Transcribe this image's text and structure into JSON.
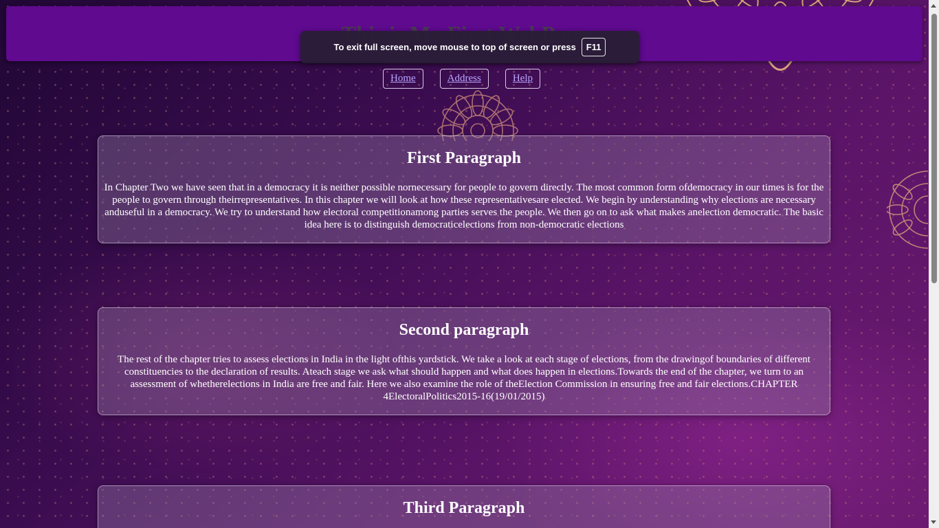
{
  "header": {
    "title": "This is My First WebPage"
  },
  "fullscreen_notice": {
    "message": "To exit full screen, move mouse to top of screen or press",
    "key": "F11"
  },
  "nav": {
    "items": [
      {
        "label": "Home"
      },
      {
        "label": "Address"
      },
      {
        "label": "Help"
      }
    ]
  },
  "sections": [
    {
      "heading": "First Paragraph",
      "body": "In Chapter Two we have seen that in a democracy it is neither possible nornecessary for people to govern directly. The most common form ofdemocracy in our times is for the people to govern through theirrepresentatives. In this chapter we will look at how these representativesare elected. We begin by understanding why elections are necessary anduseful in a democracy. We try to understand how electoral competitionamong parties serves the people. We then go on to ask what makes anelection democratic. The basic idea here is to distinguish democraticelections from non-democratic elections"
    },
    {
      "heading": "Second paragraph",
      "body": "The rest of the chapter tries to assess elections in India in the light ofthis yardstick. We take a look at each stage of elections, from the drawingof boundaries of different constituencies to the declaration of results. Ateach stage we ask what should happen and what does happen in elections.Towards the end of the chapter, we turn to an assessment of whetherelections in India are free and fair. Here we also examine the role of theElection Commission in ensuring free and fair elections.CHAPTER 4ElectoralPolitics2015-16(19/01/2015)"
    },
    {
      "heading": "Third Paragraph"
    }
  ],
  "colors": {
    "header_bg": "#5f0a8f",
    "link": "#b9a6ff",
    "mandala": "#d9a27a"
  }
}
